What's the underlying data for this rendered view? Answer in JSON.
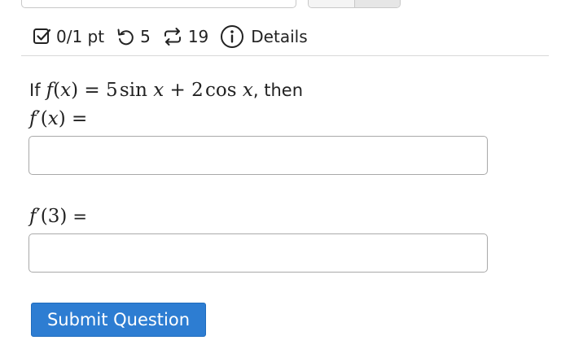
{
  "status": {
    "score": "0/1 pt",
    "retries": "5",
    "attempts": "19",
    "details_label": "Details"
  },
  "question": {
    "prefix": "If",
    "function_def": {
      "f": "f",
      "x": "x",
      "eq": "=",
      "coef1": "5",
      "sin": "sin",
      "plus": "+",
      "coef2": "2",
      "cos": "cos"
    },
    "suffix": ", then",
    "part1_lhs": {
      "f": "f",
      "prime": "′",
      "x": "x",
      "eq": "="
    },
    "part1_value": "",
    "part2_lhs": {
      "f": "f",
      "prime": "′",
      "arg": "3",
      "eq": "="
    },
    "part2_value": ""
  },
  "submit_label": "Submit Question",
  "colors": {
    "accent": "#2d7dd2",
    "text": "#222222",
    "divider": "#d8d8d8",
    "input_border": "#a9a9a9"
  },
  "icons": [
    "checkbox-icon",
    "retry-icon",
    "repeat-icon",
    "info-icon"
  ]
}
